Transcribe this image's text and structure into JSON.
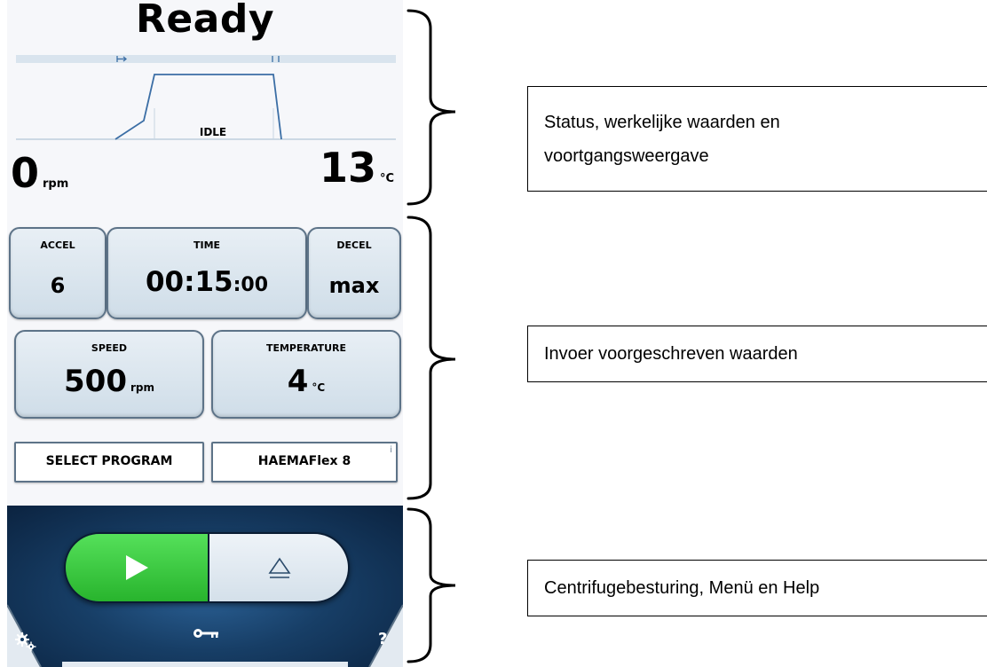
{
  "status": {
    "title": "Ready",
    "state": "IDLE",
    "speed_value": "0",
    "speed_unit": "rpm",
    "temp_value": "13",
    "temp_unit": "°C"
  },
  "setpoints": {
    "accel": {
      "label": "ACCEL",
      "value": "6"
    },
    "time": {
      "label": "TIME",
      "value_main": "00:15",
      "value_sec": ":00"
    },
    "decel": {
      "label": "DECEL",
      "value": "max"
    },
    "speed": {
      "label": "SPEED",
      "value": "500",
      "unit": "rpm"
    },
    "temperature": {
      "label": "TEMPERATURE",
      "value": "4",
      "unit": "°C"
    },
    "select_program": "SELECT PROGRAM",
    "program_name": "HAEMAFlex 8",
    "info_mark": "i"
  },
  "controls": {
    "start_icon": "play-icon",
    "open_icon": "eject-icon",
    "settings_icon": "gear-icon",
    "key_icon": "key-icon",
    "help_label": "?"
  },
  "annotations": {
    "status": [
      "Status, werkelijke waarden en",
      "voortgangsweergave"
    ],
    "setpoints": "Invoer voorgeschreven waarden",
    "controls": "Centrifugebesturing, Menü en Help"
  },
  "colors": {
    "start_green": "#32c237",
    "panel_blue": "#173e66",
    "button_border": "#5d7388"
  }
}
